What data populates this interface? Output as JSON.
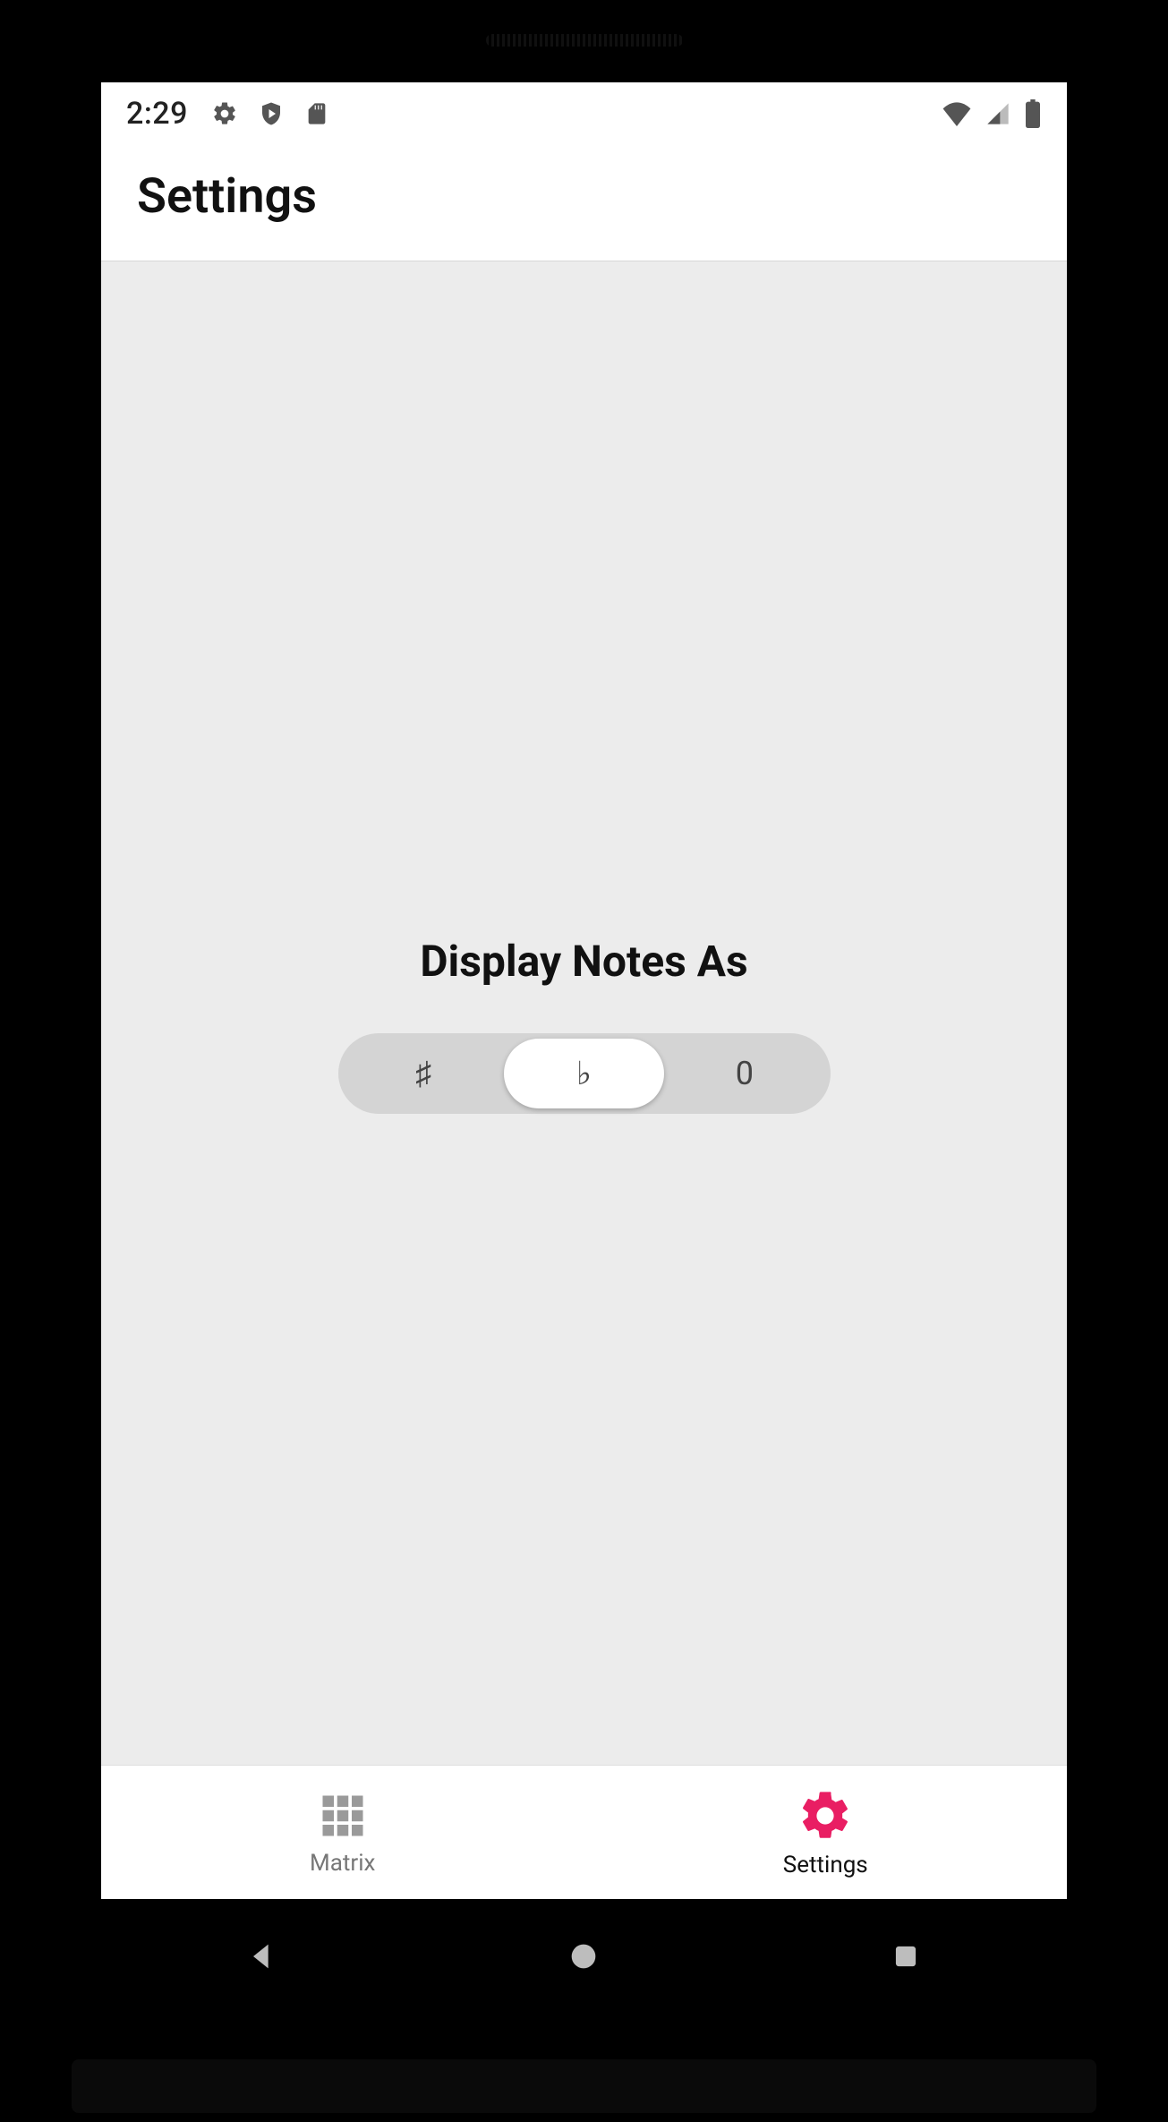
{
  "status": {
    "time": "2:29"
  },
  "header": {
    "title": "Settings"
  },
  "settings": {
    "section_title": "Display Notes As",
    "options": {
      "sharp": "♯",
      "flat": "♭",
      "number": "0"
    },
    "selected": "flat"
  },
  "nav": {
    "matrix": "Matrix",
    "settings": "Settings"
  },
  "colors": {
    "accent": "#e91e63"
  }
}
